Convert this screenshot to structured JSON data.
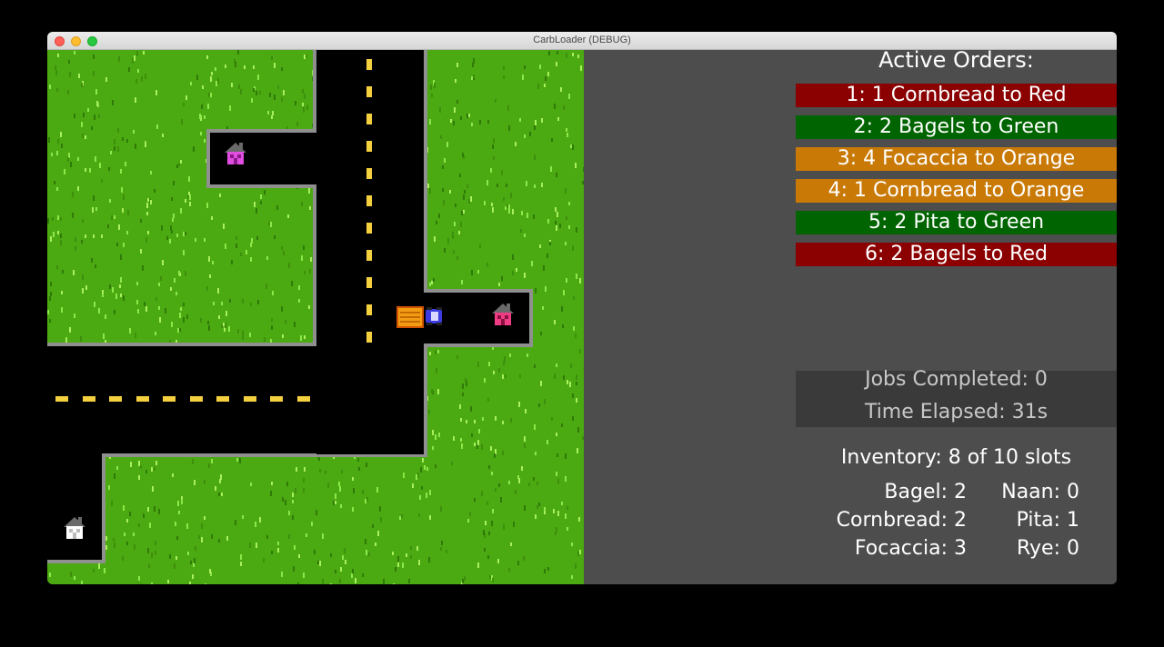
{
  "window": {
    "title": "CarbLoader (DEBUG)"
  },
  "colors": {
    "grass": "#4ba911",
    "road": "#000000",
    "lane_marking": "#f4d03f",
    "panel": "#4d4d4d",
    "red": "#8b0000",
    "green": "#006400",
    "orange": "#c97a06"
  },
  "map": {
    "houses": [
      {
        "name": "magenta-house",
        "color": "#e14de0"
      },
      {
        "name": "pink-house",
        "color": "#f03c84"
      },
      {
        "name": "white-house",
        "color": "#ffffff"
      }
    ],
    "truck": {
      "name": "delivery-truck",
      "cargo_color": "#f39c12",
      "cab_color": "#3b3be0"
    }
  },
  "orders": {
    "title": "Active Orders:",
    "items": [
      {
        "label": "1: 1 Cornbread to Red",
        "color": "#8b0000"
      },
      {
        "label": "2: 2 Bagels to Green",
        "color": "#006400"
      },
      {
        "label": "3: 4 Focaccia to Orange",
        "color": "#c97a06"
      },
      {
        "label": "4: 1 Cornbread to Orange",
        "color": "#c97a06"
      },
      {
        "label": "5: 2 Pita to Green",
        "color": "#006400"
      },
      {
        "label": "6: 2 Bagels to Red",
        "color": "#8b0000"
      }
    ]
  },
  "stats": {
    "jobs_completed": "Jobs Completed: 0",
    "time_elapsed": "Time Elapsed: 31s"
  },
  "inventory": {
    "title": "Inventory: 8 of 10 slots",
    "bagel": "Bagel: 2",
    "naan": "Naan: 0",
    "cornbread": "Cornbread: 2",
    "pita": "Pita: 1",
    "focaccia": "Focaccia: 3",
    "rye": "Rye: 0"
  }
}
